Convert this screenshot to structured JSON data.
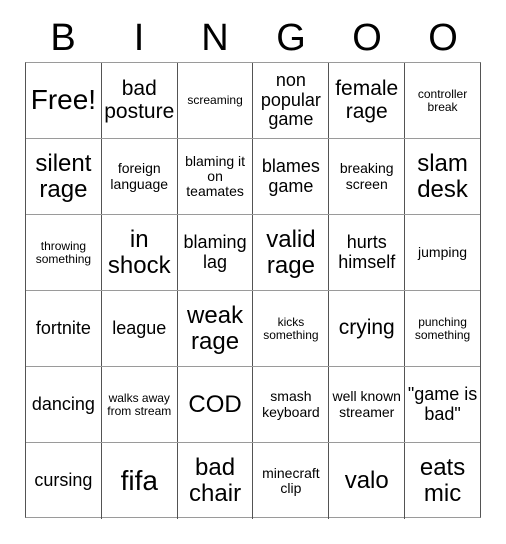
{
  "card": {
    "title_letters": [
      "B",
      "I",
      "N",
      "G",
      "O",
      "O"
    ],
    "columns": 6,
    "rows": 6,
    "colors": {
      "background": "#ffffff",
      "text": "#000000",
      "grid_vertical_line": "#545454",
      "grid_horizontal_line": "#9a9a9a"
    },
    "cells": [
      [
        {
          "text": "Free!",
          "size": "t-xxl"
        },
        {
          "text": "bad posture",
          "size": "t-lg"
        },
        {
          "text": "screaming",
          "size": "t-xs"
        },
        {
          "text": "non popular game",
          "size": "t-md"
        },
        {
          "text": "female rage",
          "size": "t-lg"
        },
        {
          "text": "controller break",
          "size": "t-xs"
        }
      ],
      [
        {
          "text": "silent rage",
          "size": "t-xl"
        },
        {
          "text": "foreign language",
          "size": "t-sm"
        },
        {
          "text": "blaming it on teamates",
          "size": "t-sm"
        },
        {
          "text": "blames game",
          "size": "t-md"
        },
        {
          "text": "breaking screen",
          "size": "t-sm"
        },
        {
          "text": "slam desk",
          "size": "t-xl"
        }
      ],
      [
        {
          "text": "throwing something",
          "size": "t-xs"
        },
        {
          "text": "in shock",
          "size": "t-xl"
        },
        {
          "text": "blaming lag",
          "size": "t-md"
        },
        {
          "text": "valid rage",
          "size": "t-xl"
        },
        {
          "text": "hurts himself",
          "size": "t-md"
        },
        {
          "text": "jumping",
          "size": "t-sm"
        }
      ],
      [
        {
          "text": "fortnite",
          "size": "t-md"
        },
        {
          "text": "league",
          "size": "t-md"
        },
        {
          "text": "weak rage",
          "size": "t-xl"
        },
        {
          "text": "kicks something",
          "size": "t-xs"
        },
        {
          "text": "crying",
          "size": "t-lg"
        },
        {
          "text": "punching something",
          "size": "t-xs"
        }
      ],
      [
        {
          "text": "dancing",
          "size": "t-md"
        },
        {
          "text": "walks away from stream",
          "size": "t-xs"
        },
        {
          "text": "COD",
          "size": "t-xl"
        },
        {
          "text": "smash keyboard",
          "size": "t-sm"
        },
        {
          "text": "well known streamer",
          "size": "t-sm"
        },
        {
          "text": "\"game is bad\"",
          "size": "t-md"
        }
      ],
      [
        {
          "text": "cursing",
          "size": "t-md"
        },
        {
          "text": "fifa",
          "size": "t-xxl"
        },
        {
          "text": "bad chair",
          "size": "t-xl"
        },
        {
          "text": "minecraft clip",
          "size": "t-sm"
        },
        {
          "text": "valo",
          "size": "t-xl"
        },
        {
          "text": "eats mic",
          "size": "t-xl"
        }
      ]
    ]
  }
}
